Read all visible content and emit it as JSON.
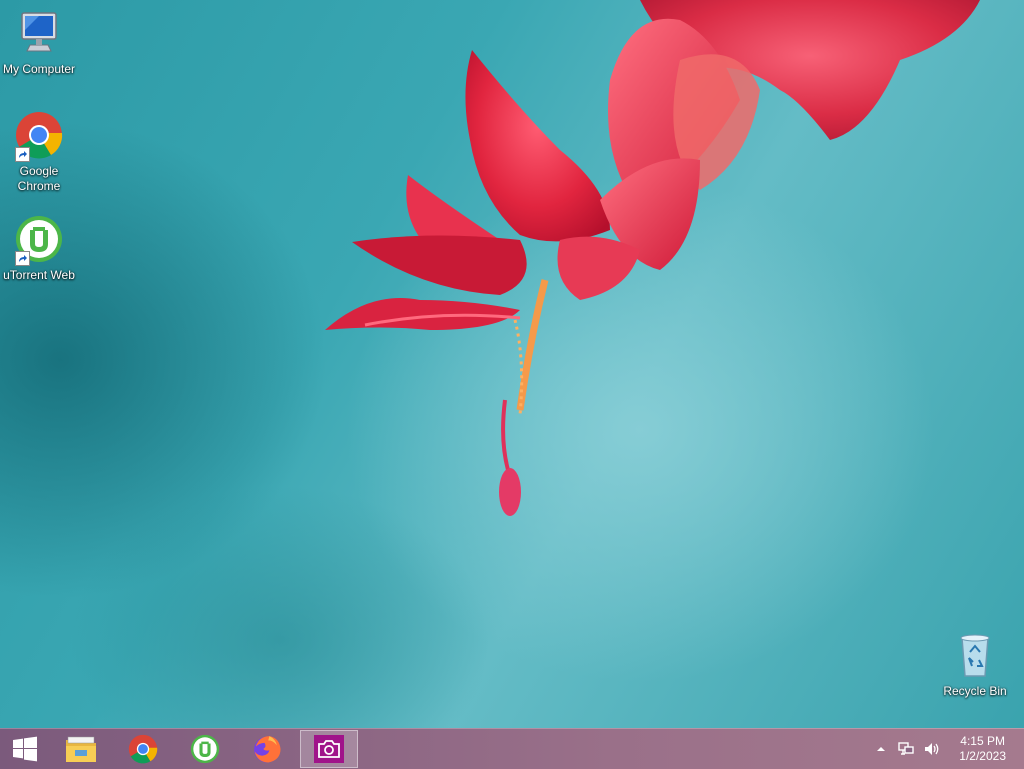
{
  "desktop": {
    "icons": [
      {
        "label": "My Computer",
        "icon": "my-computer-icon"
      },
      {
        "label": "Google Chrome",
        "icon": "chrome-icon",
        "shortcut": true
      },
      {
        "label": "uTorrent Web",
        "icon": "utorrent-icon",
        "shortcut": true
      },
      {
        "label": "Recycle Bin",
        "icon": "recycle-bin-icon"
      }
    ]
  },
  "taskbar": {
    "pinned": [
      {
        "name": "start-button",
        "icon": "windows-logo-icon"
      },
      {
        "name": "file-explorer",
        "icon": "folder-icon"
      },
      {
        "name": "chrome",
        "icon": "chrome-icon"
      },
      {
        "name": "utorrent",
        "icon": "utorrent-icon"
      },
      {
        "name": "firefox",
        "icon": "firefox-icon"
      },
      {
        "name": "camera-app",
        "icon": "camera-icon",
        "active": true
      }
    ],
    "tray": {
      "icons": [
        "show-hidden-icons-icon",
        "network-icon",
        "volume-icon"
      ],
      "time": "4:15 PM",
      "date": "1/2/2023"
    }
  },
  "colors": {
    "wallpaper_teal": "#3aa7b3",
    "flower_red": "#e0304a",
    "taskbar": "#8a6583"
  }
}
